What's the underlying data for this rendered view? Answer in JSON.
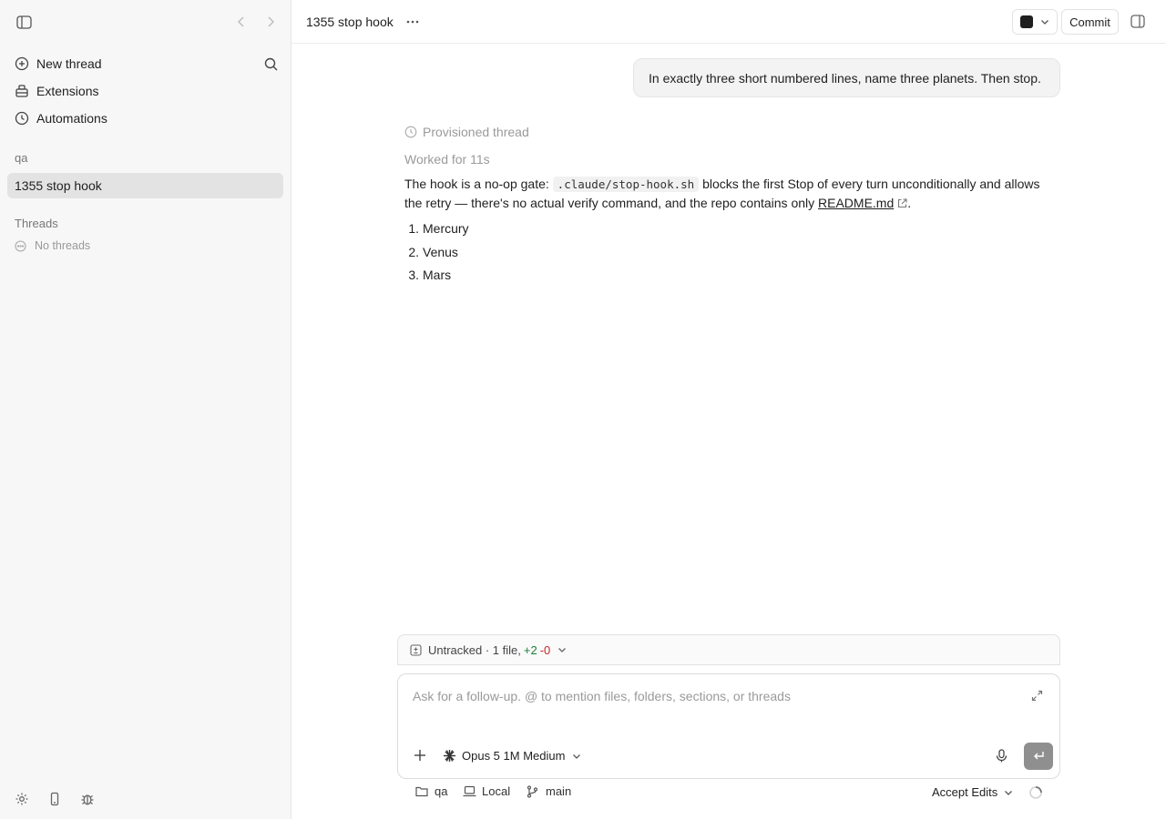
{
  "sidebar": {
    "nav": [
      {
        "label": "New thread",
        "icon": "plus-circle-icon"
      },
      {
        "label": "Extensions",
        "icon": "extensions-icon"
      },
      {
        "label": "Automations",
        "icon": "clock-icon"
      }
    ],
    "project_label": "qa",
    "active_thread": "1355 stop hook",
    "threads_label": "Threads",
    "no_threads": "No threads"
  },
  "header": {
    "title": "1355 stop hook",
    "commit_label": "Commit"
  },
  "conversation": {
    "user_message": "In exactly three short numbered lines, name three planets. Then stop.",
    "provisioned": "Provisioned thread",
    "worked_for": "Worked for 11s",
    "answer_part1": "The hook is a no-op gate: ",
    "answer_code": ".claude/stop-hook.sh",
    "answer_part2": " blocks the first Stop of every turn unconditionally and allows the retry — there's no actual verify command, and the repo contains only ",
    "answer_link": "README.md",
    "answer_part3": ".",
    "list": [
      {
        "num": "1.",
        "text": "Mercury"
      },
      {
        "num": "2.",
        "text": "Venus"
      },
      {
        "num": "3.",
        "text": "Mars"
      }
    ]
  },
  "changes": {
    "label": "Untracked · 1 file,",
    "added": "+2",
    "removed": "-0"
  },
  "composer": {
    "placeholder": "Ask for a follow-up. @ to mention files, folders, sections, or threads",
    "model": "Opus 5 1M Medium"
  },
  "footer": {
    "project": "qa",
    "env": "Local",
    "branch": "main",
    "mode": "Accept Edits"
  },
  "colors": {
    "added": "#1a7f37",
    "removed": "#c62828",
    "active_thread_bg": "#e3e3e3"
  }
}
